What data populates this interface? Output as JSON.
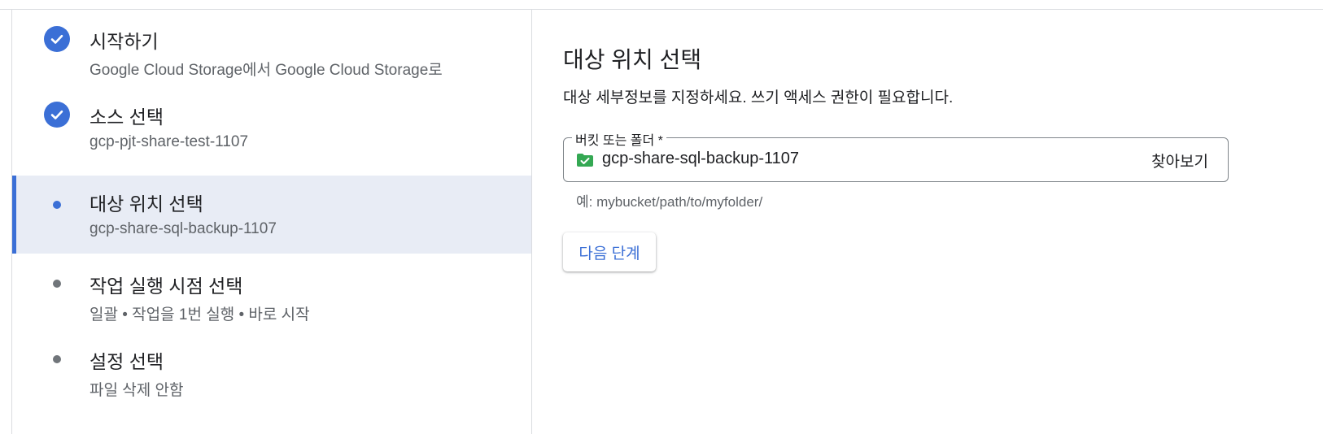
{
  "stepper": {
    "steps": [
      {
        "title": "시작하기",
        "subtitle": "Google Cloud Storage에서 Google Cloud Storage로",
        "status": "complete",
        "icon": "check-circle-icon"
      },
      {
        "title": "소스 선택",
        "subtitle": "gcp-pjt-share-test-1107",
        "status": "complete",
        "icon": "check-circle-icon"
      },
      {
        "title": "대상 위치 선택",
        "subtitle": "gcp-share-sql-backup-1107",
        "status": "current",
        "icon": "dot-icon"
      },
      {
        "title": "작업 실행 시점 선택",
        "subtitle": "일괄 • 작업을 1번 실행 • 바로 시작",
        "status": "pending",
        "icon": "dot-icon"
      },
      {
        "title": "설정 선택",
        "subtitle": "파일 삭제 안함",
        "status": "pending",
        "icon": "dot-icon"
      }
    ]
  },
  "main": {
    "title": "대상 위치 선택",
    "description": "대상 세부정보를 지정하세요. 쓰기 액세스 권한이 필요합니다.",
    "field": {
      "label": "버킷 또는 폴더 *",
      "value": "gcp-share-sql-backup-1107",
      "icon": "bucket-check-icon",
      "browse_label": "찾아보기",
      "hint": "예: mybucket/path/to/myfolder/"
    },
    "next_button": "다음 단계"
  },
  "colors": {
    "accent": "#3b6fd6",
    "active_bg": "#e8ecf5",
    "bucket_green": "#34a853"
  }
}
